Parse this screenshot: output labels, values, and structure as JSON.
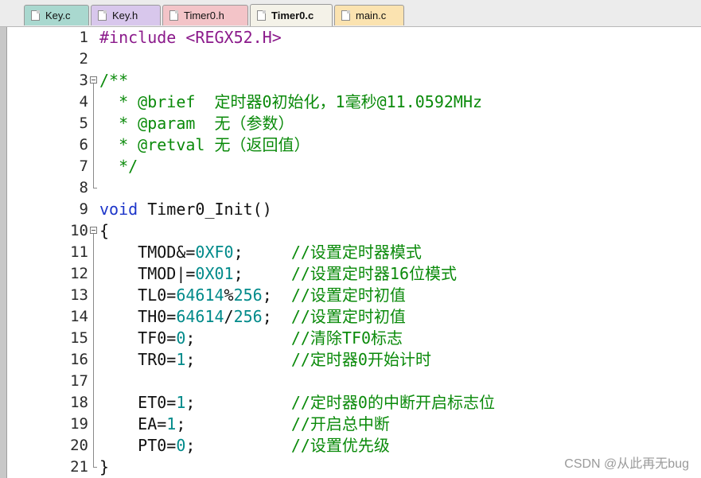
{
  "tabs": [
    {
      "label": "Key.c",
      "color": "#a9d8cf"
    },
    {
      "label": "Key.h",
      "color": "#d8c7ec"
    },
    {
      "label": "Timer0.h",
      "color": "#f3c4c8"
    },
    {
      "label": "Timer0.c",
      "color": "#f4f2e8",
      "active": true
    },
    {
      "label": "main.c",
      "color": "#fbe3b0"
    }
  ],
  "code_lines": [
    {
      "num": "1",
      "text": "#include <REGX52.H>"
    },
    {
      "num": "2",
      "text": ""
    },
    {
      "num": "3",
      "text": "/**"
    },
    {
      "num": "4",
      "text": "  * @brief  定时器0初始化，1毫秒@11.0592MHz"
    },
    {
      "num": "5",
      "text": "  * @param  无（参数）"
    },
    {
      "num": "6",
      "text": "  * @retval 无（返回值）"
    },
    {
      "num": "7",
      "text": "  */"
    },
    {
      "num": "8",
      "text": ""
    },
    {
      "num": "9",
      "text": "void Timer0_Init()"
    },
    {
      "num": "10",
      "text": "{"
    },
    {
      "num": "11",
      "text": "    TMOD&=0XF0;     //设置定时器模式"
    },
    {
      "num": "12",
      "text": "    TMOD|=0X01;     //设置定时器16位模式"
    },
    {
      "num": "13",
      "text": "    TL0=64614%256;  //设置定时初值"
    },
    {
      "num": "14",
      "text": "    TH0=64614/256;  //设置定时初值"
    },
    {
      "num": "15",
      "text": "    TF0=0;          //清除TF0标志"
    },
    {
      "num": "16",
      "text": "    TR0=1;          //定时器0开始计时"
    },
    {
      "num": "17",
      "text": ""
    },
    {
      "num": "18",
      "text": "    ET0=1;          //定时器0的中断开启标志位"
    },
    {
      "num": "19",
      "text": "    EA=1;           //开启总中断"
    },
    {
      "num": "20",
      "text": "    PT0=0;          //设置优先级"
    },
    {
      "num": "21",
      "text": "}"
    }
  ],
  "watermark": "CSDN @从此再无bug"
}
